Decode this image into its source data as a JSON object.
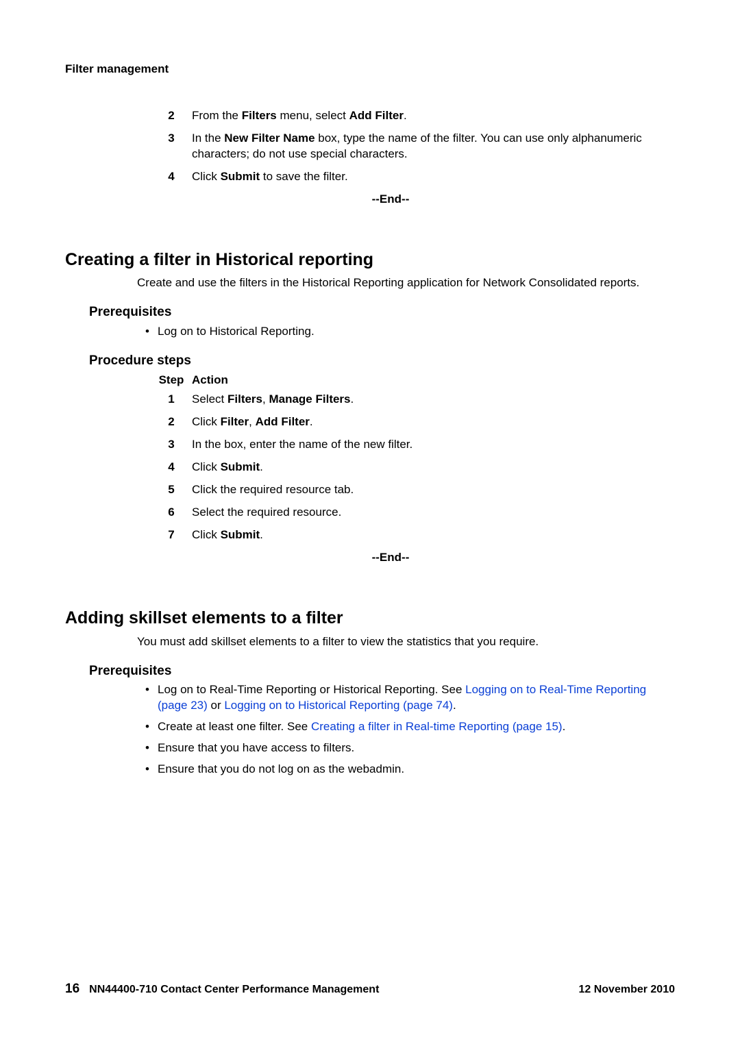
{
  "running_head": "Filter management",
  "top_steps": {
    "rows": [
      {
        "n": "2",
        "html": "From the <b>Filters</b> menu, select <b>Add Filter</b>."
      },
      {
        "n": "3",
        "html": "In the <b>New Filter Name</b> box, type the name of the filter. You can use only alphanumeric characters; do not use special characters."
      },
      {
        "n": "4",
        "html": "Click <b>Submit</b> to save the filter."
      }
    ],
    "end": "--End--"
  },
  "section1": {
    "title": "Creating a filter in Historical reporting",
    "intro": "Create and use the filters in the Historical Reporting application for Network Consolidated reports.",
    "prereq_heading": "Prerequisites",
    "prereqs": [
      {
        "html": "Log on to Historical Reporting."
      }
    ],
    "proc_heading": "Procedure steps",
    "col_step": "Step",
    "col_action": "Action",
    "steps": [
      {
        "n": "1",
        "html": "Select <b>Filters</b>, <b>Manage Filters</b>."
      },
      {
        "n": "2",
        "html": "Click <b>Filter</b>, <b>Add Filter</b>."
      },
      {
        "n": "3",
        "html": "In the box, enter the name of the new filter."
      },
      {
        "n": "4",
        "html": "Click <b>Submit</b>."
      },
      {
        "n": "5",
        "html": "Click the required resource tab."
      },
      {
        "n": "6",
        "html": "Select the required resource."
      },
      {
        "n": "7",
        "html": "Click <b>Submit</b>."
      }
    ],
    "end": "--End--"
  },
  "section2": {
    "title": "Adding skillset elements to a filter",
    "intro": "You must add skillset elements to a filter to view the statistics that you require.",
    "prereq_heading": "Prerequisites",
    "prereqs": [
      {
        "html": "Log on to Real-Time Reporting or Historical Reporting. See <span class=\"link\">Logging on to Real-Time Reporting (page 23)</span> or <span class=\"link\">Logging on to Historical Reporting (page 74)</span>."
      },
      {
        "html": "Create at least one filter. See <span class=\"link\">Creating a filter in Real-time Reporting (page 15)</span>."
      },
      {
        "html": "Ensure that you have access to filters."
      },
      {
        "html": "Ensure that you do not log on as the webadmin."
      }
    ]
  },
  "footer": {
    "page_num": "16",
    "doc_id": "NN44400-710 Contact Center Performance Management",
    "date": "12 November 2010"
  }
}
